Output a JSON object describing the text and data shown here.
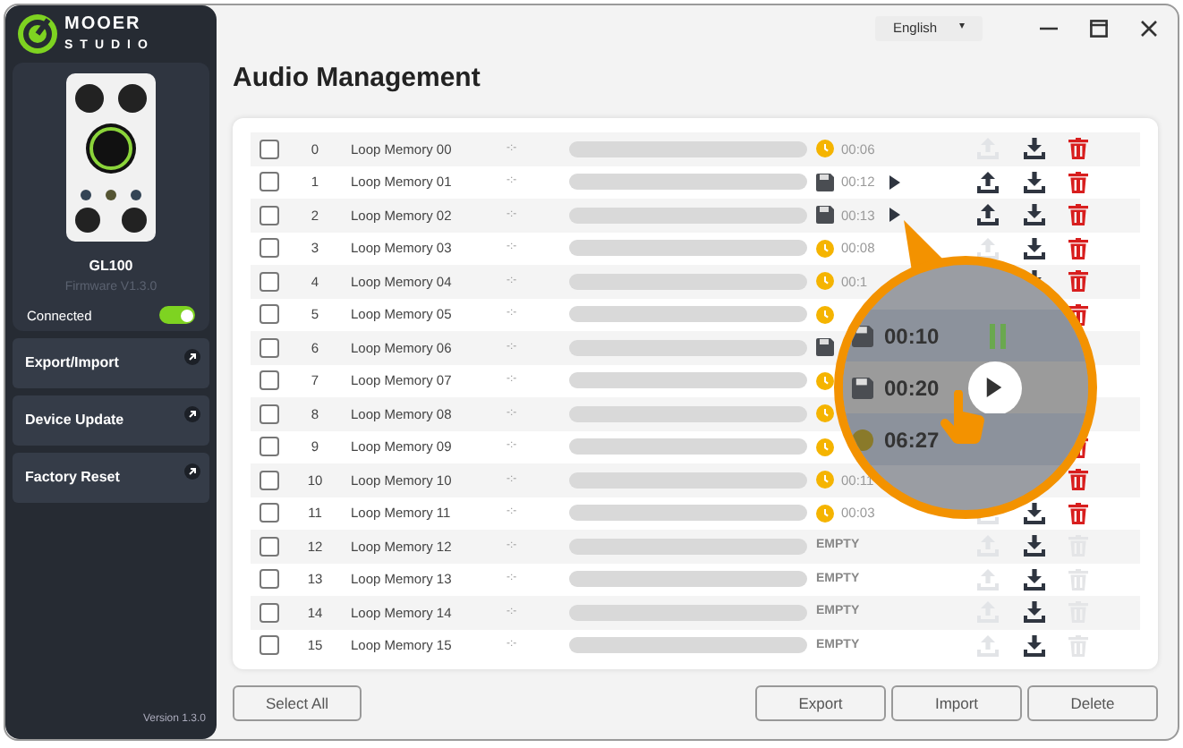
{
  "logo": {
    "brand": "MOOER",
    "sub": "STUDIO"
  },
  "device": {
    "name": "GL100",
    "firmware": "Firmware V1.3.0",
    "status": "Connected",
    "on": true
  },
  "nav": [
    "Export/Import",
    "Device Update",
    "Factory Reset"
  ],
  "version": "Version 1.3.0",
  "language": {
    "value": "English",
    "caret": "▾"
  },
  "title": "Audio Management",
  "rows": [
    {
      "checked": false,
      "index": "0",
      "name": "Loop Memory 00",
      "tempo": "-:-",
      "kind": "clock",
      "time": "00:06",
      "play": false,
      "upload": false,
      "download": true,
      "delete": true
    },
    {
      "checked": false,
      "index": "1",
      "name": "Loop Memory 01",
      "tempo": "-:-",
      "kind": "disk",
      "time": "00:12",
      "play": true,
      "upload": true,
      "download": true,
      "delete": true
    },
    {
      "checked": false,
      "index": "2",
      "name": "Loop Memory 02",
      "tempo": "-:-",
      "kind": "disk",
      "time": "00:13",
      "play": true,
      "upload": true,
      "download": true,
      "delete": true
    },
    {
      "checked": false,
      "index": "3",
      "name": "Loop Memory 03",
      "tempo": "-:-",
      "kind": "clock",
      "time": "00:08",
      "play": false,
      "upload": false,
      "download": true,
      "delete": true
    },
    {
      "checked": false,
      "index": "4",
      "name": "Loop Memory 04",
      "tempo": "-:-",
      "kind": "clock",
      "time": "00:1",
      "download": true,
      "delete": true
    },
    {
      "checked": false,
      "index": "5",
      "name": "Loop Memory 05",
      "tempo": "-:-",
      "kind": "clock",
      "delete": true
    },
    {
      "checked": false,
      "index": "6",
      "name": "Loop Memory 06",
      "tempo": "-:-",
      "kind": "disk"
    },
    {
      "checked": false,
      "index": "7",
      "name": "Loop Memory 07",
      "tempo": "-:-",
      "kind": "clock"
    },
    {
      "checked": false,
      "index": "8",
      "name": "Loop Memory 08",
      "tempo": "-:-",
      "kind": "clock"
    },
    {
      "checked": false,
      "index": "9",
      "name": "Loop Memory 09",
      "tempo": "-:-",
      "kind": "clock",
      "delete": true
    },
    {
      "checked": false,
      "index": "10",
      "name": "Loop Memory 10",
      "tempo": "-:-",
      "kind": "clock",
      "time": "00:11",
      "delete": true
    },
    {
      "checked": false,
      "index": "11",
      "name": "Loop Memory 11",
      "tempo": "-:-",
      "kind": "clock",
      "time": "00:03",
      "play": false,
      "upload": false,
      "download": true,
      "delete": true
    },
    {
      "checked": false,
      "index": "12",
      "name": "Loop Memory 12",
      "tempo": "-:-",
      "kind": "empty",
      "time": "EMPTY",
      "play": false,
      "upload": false,
      "download": true,
      "delete": false
    },
    {
      "checked": false,
      "index": "13",
      "name": "Loop Memory 13",
      "tempo": "-:-",
      "kind": "empty",
      "time": "EMPTY",
      "play": false,
      "upload": false,
      "download": true,
      "delete": false
    },
    {
      "checked": false,
      "index": "14",
      "name": "Loop Memory 14",
      "tempo": "-:-",
      "kind": "empty",
      "time": "EMPTY",
      "play": false,
      "upload": false,
      "download": true,
      "delete": false
    },
    {
      "checked": false,
      "index": "15",
      "name": "Loop Memory 15",
      "tempo": "-:-",
      "kind": "empty",
      "time": "EMPTY",
      "play": false,
      "upload": false,
      "download": true,
      "delete": false
    }
  ],
  "lens": [
    {
      "kind": "disk",
      "time": "00:10",
      "playing": true,
      "play_button": false
    },
    {
      "kind": "disk",
      "time": "00:20",
      "playing": false,
      "play_button": true
    },
    {
      "kind": "clock",
      "time": "06:27",
      "playing": false,
      "play_button": false
    }
  ],
  "select_all": "Select All",
  "actions": [
    "Export",
    "Import",
    "Delete"
  ]
}
